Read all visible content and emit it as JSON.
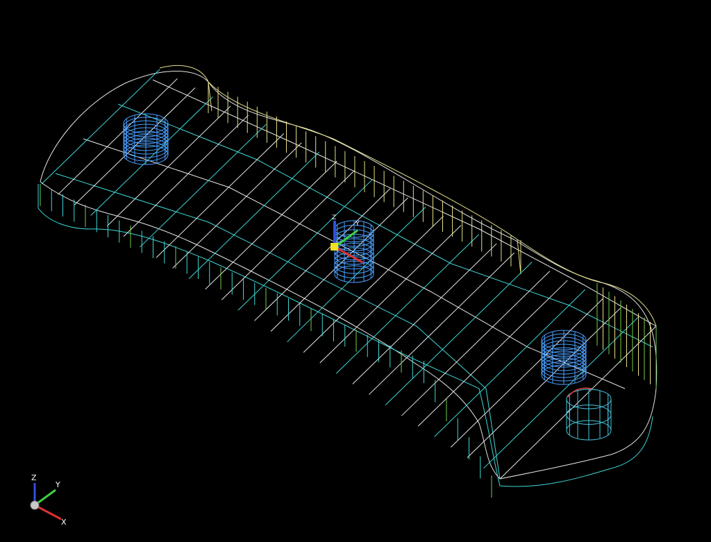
{
  "scene": {
    "background": "#000000",
    "colors": {
      "edge_cyan": "#40d8d8",
      "edge_white": "#e8e8e8",
      "edge_yellow": "#e6e08a",
      "edge_green": "#6fcf4a",
      "hole_blue": "#4aa0ff",
      "hole_dark": "#2a66c8",
      "hole_cyan": "#45c8e0",
      "accent_red": "#e04040",
      "axis_x": "#e03030",
      "axis_y": "#40d040",
      "axis_z": "#3050e0",
      "origin_yellow": "#f0e020"
    }
  },
  "triad": {
    "x_label": "X",
    "y_label": "Y",
    "z_label": "Z"
  },
  "model_triad": {
    "y_label": "Y",
    "z_label": "Z"
  }
}
